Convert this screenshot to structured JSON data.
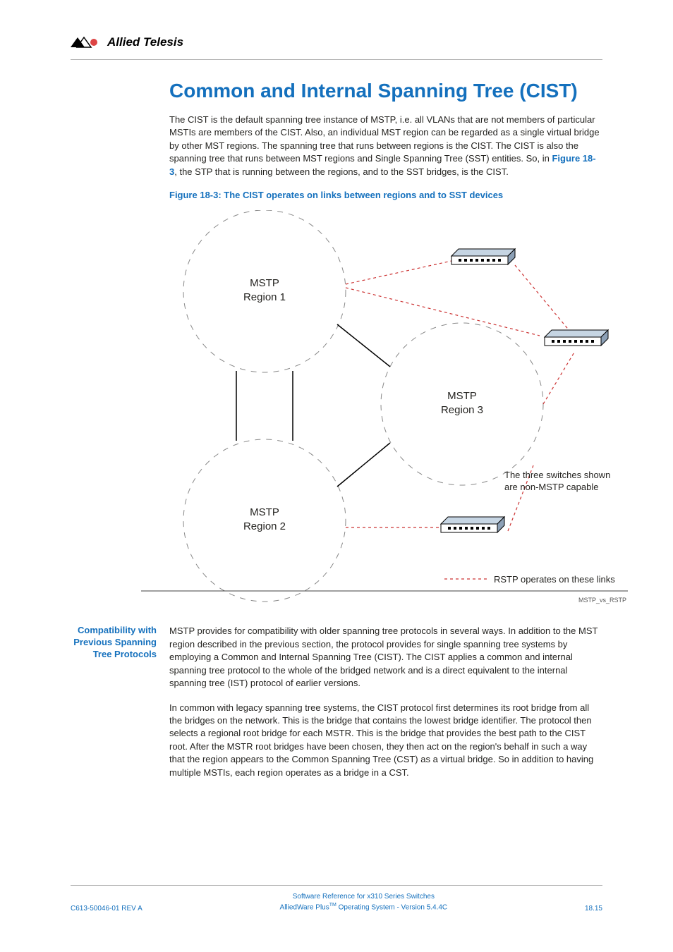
{
  "header": {
    "brand": "Allied Telesis"
  },
  "title": "Common and Internal Spanning Tree (CIST)",
  "para1_a": "The CIST is the default spanning tree instance of MSTP, i.e. all VLANs that are not members of particular MSTIs are members of the CIST. Also, an individual MST region can be regarded as a single virtual bridge by other MST regions. The spanning tree that runs between regions is the CIST. The CIST is also the spanning tree that runs between MST regions and Single Spanning Tree (SST) entities. So, in ",
  "para1_link": "Figure 18-3",
  "para1_b": ", the STP that is running between the regions, and to the SST bridges, is the CIST.",
  "figcaption": "Figure 18-3: The CIST operates on links between regions and to SST devices",
  "diagram": {
    "region1": "MSTP\nRegion 1",
    "region2": "MSTP\nRegion 2",
    "region3": "MSTP\nRegion 3",
    "note1": "The three switches shown are non-MSTP capable",
    "legend": "RSTP operates on these links",
    "code": "MSTP_vs_RSTP"
  },
  "sidehead": "Compatibility with Previous Spanning Tree Protocols",
  "para2": "MSTP provides for compatibility with older spanning tree protocols in several ways. In addition to the MST region described in the previous section, the protocol provides for single spanning tree systems by employing a Common and Internal Spanning Tree (CIST). The CIST applies a common and internal spanning tree protocol to the whole of the bridged network and is a direct equivalent to the internal spanning tree (IST) protocol of earlier versions.",
  "para3": "In common with legacy spanning tree systems, the CIST protocol first determines its root bridge from all the bridges on the network. This is the bridge that contains the lowest bridge identifier. The protocol then selects a regional root bridge for each MSTR. This is the bridge that provides the best path to the CIST root. After the MSTR root bridges have been chosen, they then act on the region's behalf in such a way that the region appears to the Common Spanning Tree (CST) as a virtual bridge. So in addition to having multiple MSTIs, each region operates as a bridge in a CST.",
  "footer": {
    "left": "C613-50046-01 REV A",
    "center1": "Software Reference for x310 Series Switches",
    "center2a": "AlliedWare Plus",
    "center2b": "TM",
    "center2c": " Operating System - Version 5.4.4C",
    "right": "18.15"
  }
}
